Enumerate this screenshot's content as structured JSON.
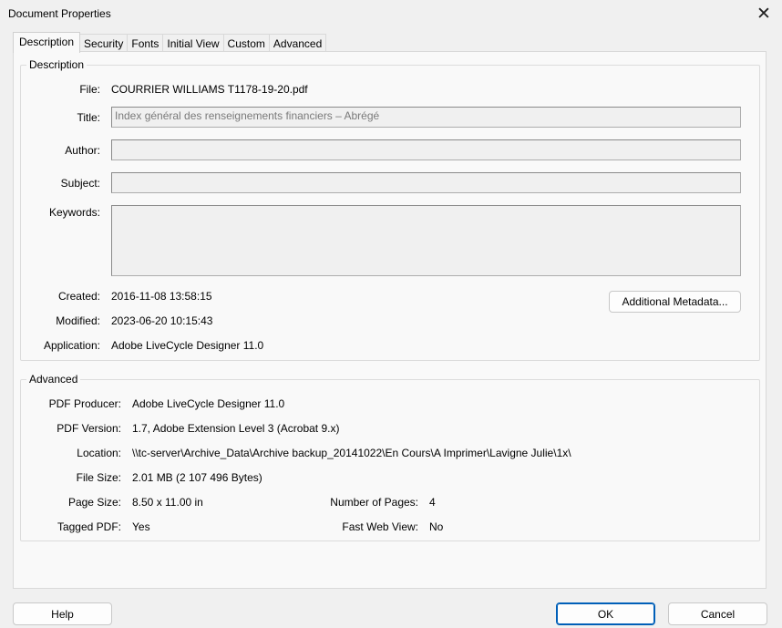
{
  "window": {
    "title": "Document Properties"
  },
  "tabs": [
    "Description",
    "Security",
    "Fonts",
    "Initial View",
    "Custom",
    "Advanced"
  ],
  "description": {
    "group_label": "Description",
    "file_label": "File:",
    "file_value": "COURRIER WILLIAMS T1178-19-20.pdf",
    "title_label": "Title:",
    "title_value": "Index général des renseignements financiers – Abrégé",
    "author_label": "Author:",
    "author_value": "",
    "subject_label": "Subject:",
    "subject_value": "",
    "keywords_label": "Keywords:",
    "keywords_value": "",
    "created_label": "Created:",
    "created_value": "2016-11-08 13:58:15",
    "modified_label": "Modified:",
    "modified_value": "2023-06-20 10:15:43",
    "application_label": "Application:",
    "application_value": "Adobe LiveCycle Designer 11.0",
    "metadata_button": "Additional Metadata..."
  },
  "advanced": {
    "group_label": "Advanced",
    "producer_label": "PDF Producer:",
    "producer_value": "Adobe LiveCycle Designer 11.0",
    "version_label": "PDF Version:",
    "version_value": "1.7, Adobe Extension Level 3 (Acrobat 9.x)",
    "location_label": "Location:",
    "location_value": "\\\\tc-server\\Archive_Data\\Archive backup_20141022\\En Cours\\A Imprimer\\Lavigne Julie\\1x\\",
    "filesize_label": "File Size:",
    "filesize_value": "2.01 MB (2 107 496 Bytes)",
    "pagesize_label": "Page Size:",
    "pagesize_value": "8.50 x 11.00 in",
    "numpages_label": "Number of Pages:",
    "numpages_value": "4",
    "tagged_label": "Tagged PDF:",
    "tagged_value": "Yes",
    "fastweb_label": "Fast Web View:",
    "fastweb_value": "No"
  },
  "footer": {
    "help": "Help",
    "ok": "OK",
    "cancel": "Cancel"
  }
}
